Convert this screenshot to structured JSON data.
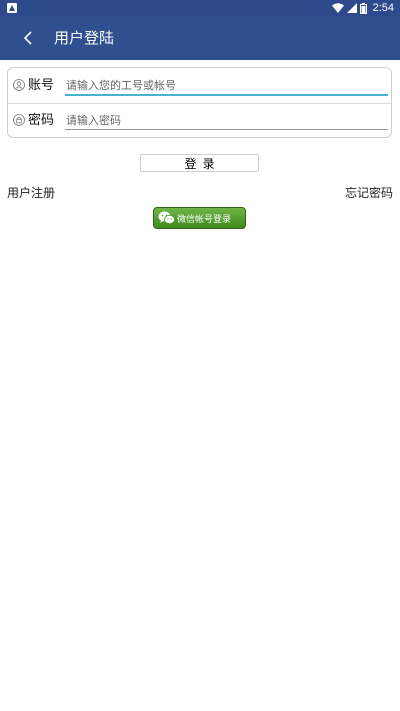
{
  "status_bar": {
    "time": "2:54"
  },
  "app_bar": {
    "title": "用户登陆"
  },
  "form": {
    "account": {
      "label": "账号",
      "placeholder": "请输入您的工号或帐号",
      "value": ""
    },
    "password": {
      "label": "密码",
      "placeholder": "请输入密码",
      "value": ""
    }
  },
  "login_button": {
    "label": "登录"
  },
  "links": {
    "register": "用户注册",
    "forgot": "忘记密码"
  },
  "wechat_button": {
    "label": "微信帐号登录"
  },
  "colors": {
    "app_bar": "#2f4f8f",
    "status_bar": "#2c4a8c",
    "focus_underline": "#46b4cf",
    "wechat_green": "#4e9a2a"
  }
}
